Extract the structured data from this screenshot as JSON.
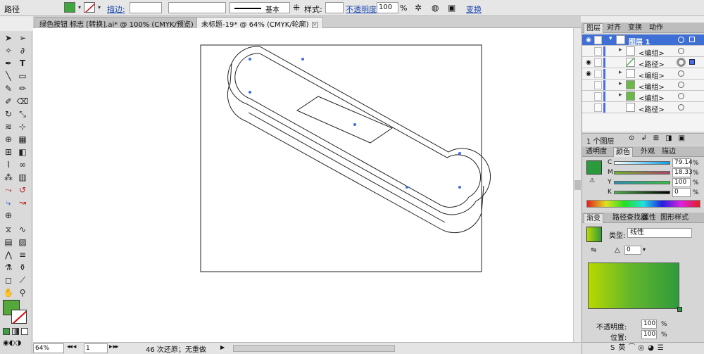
{
  "control_bar": {
    "selection_label": "路径",
    "stroke_label": "描边:",
    "stroke_profile": "基本",
    "style_label": "样式:",
    "opacity_label": "不透明度:",
    "opacity_value": "100",
    "opacity_unit": "%",
    "transform_label": "变换"
  },
  "doc_tabs": [
    {
      "title": "绿色按钮 标志 [转换].ai* @ 100% (CMYK/预览)",
      "close": "×"
    },
    {
      "title": "未标题-19* @ 64% (CMYK/轮廓)",
      "close": "×"
    }
  ],
  "layers_panel": {
    "tabs": [
      "图层",
      "对齐",
      "变换",
      "动作"
    ],
    "rows": [
      {
        "name": "图层 1",
        "eye": "◉",
        "tri": "▾"
      },
      {
        "name": "<编组>",
        "eye": "",
        "tri": "▸"
      },
      {
        "name": "<路径>",
        "eye": "◉",
        "tri": ""
      },
      {
        "name": "<编组>",
        "eye": "◉",
        "tri": "▸"
      },
      {
        "name": "<编组>",
        "eye": "",
        "tri": "▸"
      },
      {
        "name": "<编组>",
        "eye": "",
        "tri": "▸"
      },
      {
        "name": "<路径>",
        "eye": "",
        "tri": ""
      }
    ],
    "footer_count": "1 个图层"
  },
  "color_panel": {
    "tabs": [
      "透明度",
      "颜色",
      "外观",
      "描边"
    ],
    "channels": [
      {
        "label": "C",
        "value": "79.14",
        "unit": "%",
        "gradient": "linear-gradient(90deg,#fff,#00a0e9)"
      },
      {
        "label": "M",
        "value": "18.33",
        "unit": "%",
        "gradient": "linear-gradient(90deg,#6ab42b,#b0406a)"
      },
      {
        "label": "Y",
        "value": "100",
        "unit": "%",
        "gradient": "linear-gradient(90deg,#2a8fb0,#3bbf3b)"
      },
      {
        "label": "K",
        "value": "0",
        "unit": "%",
        "gradient": "linear-gradient(90deg,#4fb04f,#000)"
      }
    ],
    "fill_color": "#2b9a3c"
  },
  "gradient_panel": {
    "tabs": [
      "渐变",
      "路径查找器",
      "属性",
      "图形样式"
    ],
    "type_label": "类型:",
    "type_value": "线性",
    "angle_value": "0",
    "opacity_label": "不透明度:",
    "opacity_value": "100",
    "position_label": "位置:",
    "position_value": "100",
    "unit": "%",
    "ramp": "linear-gradient(90deg,#b8d800,#66b82a 45%,#2f9a3c)"
  },
  "status_bar": {
    "zoom": "64%",
    "page": "1",
    "message": "46 次还原；无重做"
  },
  "tools": {
    "fill_color": "#54a83a"
  }
}
